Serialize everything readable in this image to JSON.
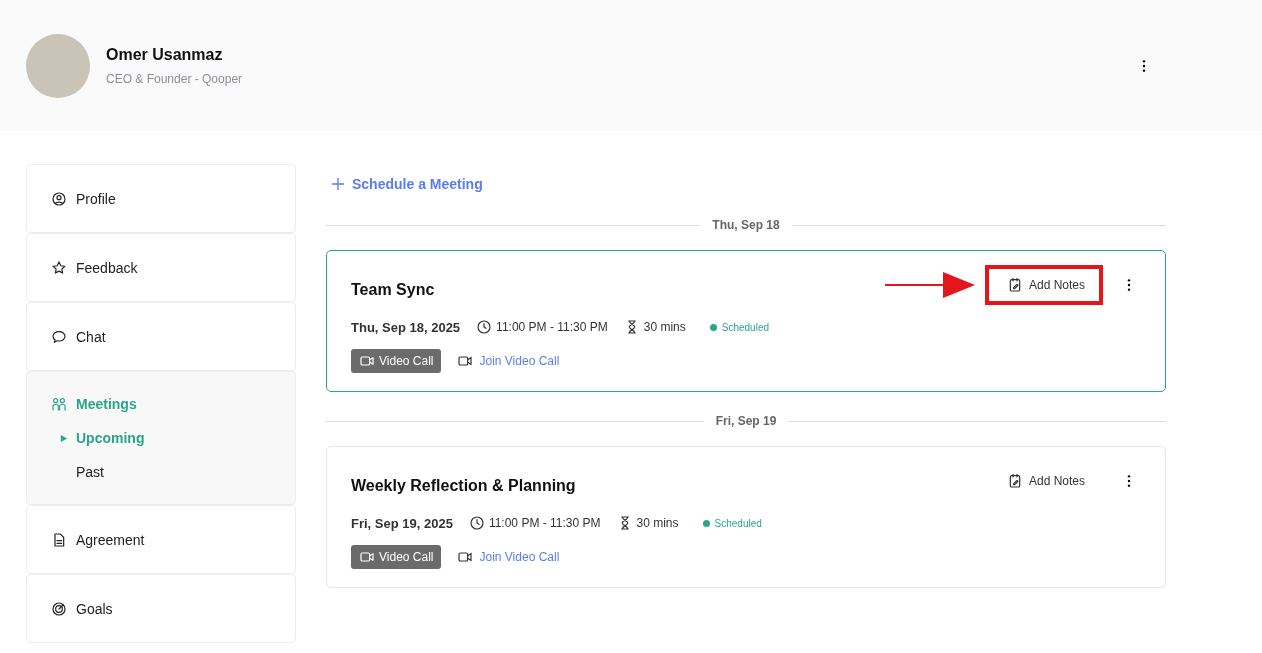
{
  "profile": {
    "name": "Omer Usanmaz",
    "role": "CEO & Founder - Qooper"
  },
  "sidebar": {
    "items": [
      {
        "label": "Profile",
        "selected": false
      },
      {
        "label": "Feedback",
        "selected": false
      },
      {
        "label": "Chat",
        "selected": false
      },
      {
        "label": "Meetings",
        "selected": true,
        "children": [
          {
            "label": "Upcoming",
            "selected": true
          },
          {
            "label": "Past",
            "selected": false
          }
        ]
      },
      {
        "label": "Agreement",
        "selected": false
      },
      {
        "label": "Goals",
        "selected": false
      }
    ]
  },
  "schedule_button": "Schedule a Meeting",
  "groups": [
    {
      "date": "Thu, Sep 18",
      "meetings": [
        {
          "title": "Team Sync",
          "date": "Thu, Sep 18, 2025",
          "time": "11:00 PM - 11:30 PM",
          "duration": "30 mins",
          "status": {
            "label": "Scheduled",
            "color": "#2aa58a"
          },
          "video_badge": "Video Call",
          "join_link": "Join Video Call",
          "add_notes": "Add Notes",
          "selected": true,
          "highlighted": true
        }
      ]
    },
    {
      "date": "Fri, Sep 19",
      "meetings": [
        {
          "title": "Weekly Reflection & Planning",
          "date": "Fri, Sep 19, 2025",
          "time": "11:00 PM - 11:30 PM",
          "duration": "30 mins",
          "status": {
            "label": "Scheduled",
            "color": "#2aa58a"
          },
          "video_badge": "Video Call",
          "join_link": "Join Video Call",
          "add_notes": "Add Notes",
          "selected": false,
          "highlighted": false
        }
      ]
    }
  ]
}
